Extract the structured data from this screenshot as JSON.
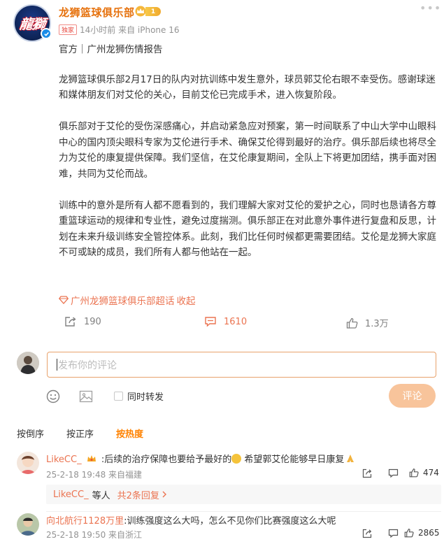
{
  "post": {
    "author": "龙狮篮球俱乐部",
    "level": "1",
    "exclusive_tag": "独家",
    "meta": "14小时前 来自 iPhone 16",
    "headline": "官方｜广州龙狮伤情报告",
    "paragraphs": [
      "龙狮篮球俱乐部2月17日的队内对抗训练中发生意外，球员郭艾伦右眼不幸受伤。感谢球迷和媒体朋友们对艾伦的关心，目前艾伦已完成手术，进入恢复阶段。",
      "俱乐部对于艾伦的受伤深感痛心，并启动紧急应对预案，第一时间联系了中山大学中山眼科中心的国内顶尖眼科专家为艾伦进行手术、确保艾伦得到最好的治疗。俱乐部后续也将尽全力为艾伦的康复提供保障。我们坚信，在艾伦康复期间，全队上下将更加团结，携手面对困难，共同为艾伦而战。",
      "训练中的意外是所有人都不愿看到的，我们理解大家对艾伦的爱护之心，同时也恳请各方尊重篮球运动的规律和专业性，避免过度揣测。俱乐部正在对此意外事件进行复盘和反思，计划在未来升级训练安全管控体系。此刻，我们比任何时候都更需要团结。艾伦是龙狮大家庭不可或缺的成员，我们所有人都与他站在一起。"
    ],
    "supertopic": "广州龙狮篮球俱乐部超话",
    "collapse_label": "收起"
  },
  "actions": {
    "repost_count": "190",
    "comment_count": "1610",
    "like_count": "1.3万"
  },
  "compose": {
    "placeholder": "发布你的评论",
    "repost_label": "同时转发",
    "submit_label": "评论"
  },
  "sort_tabs": [
    "按倒序",
    "按正序",
    "按热度"
  ],
  "comments": [
    {
      "name": "LikeCC_",
      "text_before": ":后续的治疗保障也要给予最好的",
      "text_after": " 希望郭艾伦能够早日康复",
      "time": "25-2-18 19:48 来自福建",
      "likes": "474",
      "reply_name": "LikeCC_",
      "reply_text": "等人",
      "reply_count": "共2条回复"
    },
    {
      "name": "向北航行1128万里",
      "text": ":训练强度这么大吗，怎么不见你们比赛强度这么大呢",
      "time": "25-2-18 19:50 来自浙江",
      "likes": "2865"
    }
  ],
  "colors": {
    "accent": "#eb7350",
    "author": "#e6710c",
    "active_tab": "#ff8200",
    "submit_disabled": "#f8c49b"
  }
}
